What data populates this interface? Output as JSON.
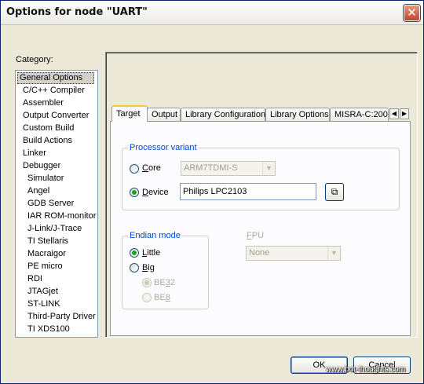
{
  "window": {
    "title": "Options for node \"UART\"",
    "close_glyph": "✕"
  },
  "category": {
    "label": "Category:",
    "items": [
      "General Options",
      "C/C++ Compiler",
      "Assembler",
      "Output Converter",
      "Custom Build",
      "Build Actions",
      "Linker",
      "Debugger",
      "Simulator",
      "Angel",
      "GDB Server",
      "IAR ROM-monitor",
      "J-Link/J-Trace",
      "TI Stellaris",
      "Macraigor",
      "PE micro",
      "RDI",
      "JTAGjet",
      "ST-LINK",
      "Third-Party Driver",
      "TI XDS100"
    ],
    "selected": "General Options"
  },
  "tabs": [
    "Target",
    "Output",
    "Library Configuration",
    "Library Options",
    "MISRA-C:200"
  ],
  "active_tab": "Target",
  "tab_scroll": {
    "left": "◀",
    "right": "▶"
  },
  "processor_variant": {
    "label": "Processor variant",
    "core": {
      "label_prefix": "",
      "label_key": "C",
      "label_rest": "ore",
      "value": "ARM7TDMI-S",
      "selected": false
    },
    "device": {
      "label_key": "D",
      "label_rest": "evice",
      "value": "Philips LPC2103",
      "selected": true
    }
  },
  "endian_mode": {
    "label": "Endian mode",
    "little": {
      "label_key": "L",
      "label_rest": "ittle",
      "selected": true
    },
    "big": {
      "label_key": "B",
      "label_rest": "ig",
      "selected": false
    },
    "be32": {
      "label_prefix": "BE",
      "label_key": "3",
      "label_rest": "2",
      "selected": true
    },
    "be8": {
      "label_prefix": "BE",
      "label_key": "8",
      "label_rest": "",
      "selected": false
    }
  },
  "fpu": {
    "label_key": "F",
    "label_rest": "PU",
    "value": "None"
  },
  "buttons": {
    "ok": "OK",
    "cancel": "Cancel"
  },
  "watermark": "www.bot-thoughts.com",
  "colors": {
    "group_label": "#0046d5",
    "tab_highlight": "#ffc83c",
    "radio_dot": "#21a121"
  }
}
